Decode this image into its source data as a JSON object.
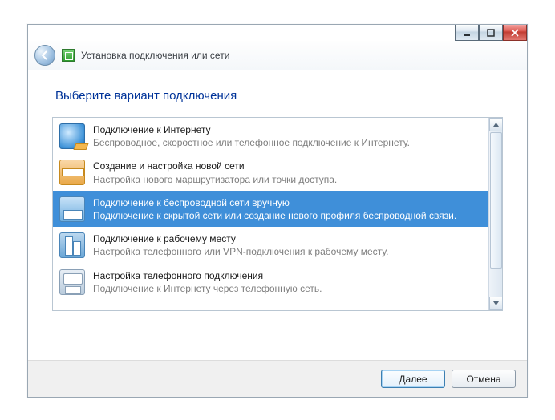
{
  "window": {
    "title": "Установка подключения или сети"
  },
  "heading": "Выберите вариант подключения",
  "options": [
    {
      "title": "Подключение к Интернету",
      "desc": "Беспроводное, скоростное или телефонное подключение к Интернету."
    },
    {
      "title": "Создание и настройка новой сети",
      "desc": "Настройка нового маршрутизатора или точки доступа."
    },
    {
      "title": "Подключение к беспроводной сети вручную",
      "desc": "Подключение к скрытой сети или создание нового профиля беспроводной связи."
    },
    {
      "title": "Подключение к рабочему месту",
      "desc": "Настройка телефонного или VPN-подключения к рабочему месту."
    },
    {
      "title": "Настройка телефонного подключения",
      "desc": "Подключение к Интернету через телефонную сеть."
    }
  ],
  "selected_index": 2,
  "buttons": {
    "next": "Далее",
    "cancel": "Отмена"
  }
}
